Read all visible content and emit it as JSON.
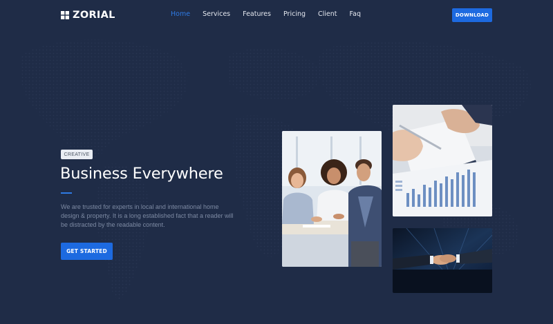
{
  "brand": {
    "name": "ZORIAL",
    "icon": "grid-logo-icon"
  },
  "nav": {
    "items": [
      {
        "label": "Home",
        "active": true
      },
      {
        "label": "Services",
        "active": false
      },
      {
        "label": "Features",
        "active": false
      },
      {
        "label": "Pricing",
        "active": false
      },
      {
        "label": "Client",
        "active": false
      },
      {
        "label": "Faq",
        "active": false
      }
    ],
    "download_label": "DOWNLOAD"
  },
  "hero": {
    "badge": "CREATIVE",
    "title": "Business Everywhere",
    "description": "We are trusted for experts in local and international home design & property. It is a long established fact that a reader will be distracted by the readable content.",
    "cta_label": "GET STARTED"
  },
  "images": [
    {
      "name": "team-meeting-photo",
      "description": "team meeting"
    },
    {
      "name": "chart-signing-photo",
      "description": "document with chart"
    },
    {
      "name": "handshake-photo",
      "description": "handshake"
    }
  ],
  "colors": {
    "background": "#1f2c47",
    "accent": "#1d6ae0",
    "active_link": "#2f7be5",
    "muted_text": "#7d8aa3"
  }
}
